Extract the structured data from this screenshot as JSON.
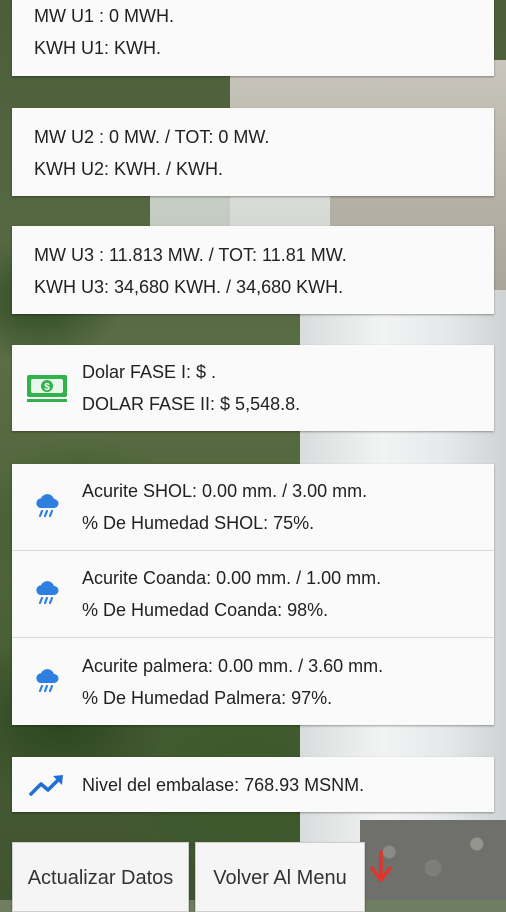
{
  "units": {
    "u1": {
      "mw": "MW U1 : 0 MWH.",
      "kwh": "KWH U1: KWH."
    },
    "u2": {
      "mw": "MW U2 : 0 MW. / TOT: 0 MW.",
      "kwh": "KWH U2: KWH. / KWH."
    },
    "u3": {
      "mw": "MW U3 : 11.813 MW. / TOT: 11.81 MW.",
      "kwh": "KWH U3: 34,680 KWH. / 34,680 KWH."
    }
  },
  "dolar": {
    "fase1": "Dolar FASE I: $ .",
    "fase2": "DOLAR FASE II: $ 5,548.8.",
    "icon": "money-bill-icon",
    "color": "#2fb34a"
  },
  "rain": [
    {
      "line1": "Acurite SHOL: 0.00 mm. / 3.00 mm.",
      "line2": "% De Humedad SHOL: 75%."
    },
    {
      "line1": "Acurite Coanda: 0.00 mm. / 1.00 mm.",
      "line2": "% De Humedad Coanda: 98%."
    },
    {
      "line1": "Acurite palmera: 0.00 mm. / 3.60 mm.",
      "line2": "% De Humedad Palmera: 97%."
    }
  ],
  "rain_icon": {
    "name": "rain-cloud-icon",
    "color": "#2f7fe0"
  },
  "nivel": {
    "text": "Nivel del embalase: 768.93 MSNM.",
    "icon": "trending-up-icon",
    "color": "#1f6fd8"
  },
  "buttons": {
    "actualizar": "Actualizar Datos",
    "volver": "Volver Al Menu"
  },
  "scroll_hint": {
    "icon": "arrow-down-icon",
    "color": "#e2332b"
  }
}
